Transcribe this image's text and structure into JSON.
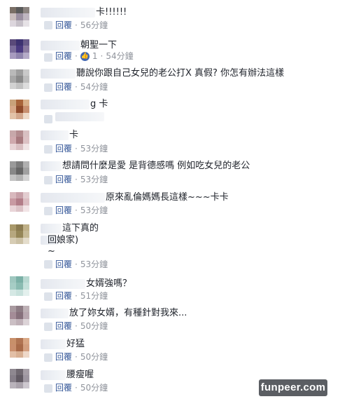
{
  "actions": {
    "reply_label": "回覆",
    "separator": "·"
  },
  "comments": [
    {
      "lines": [
        "卡!!!!!!"
      ],
      "time": "56分鐘",
      "likes": null,
      "avatar": [
        "#7a6f66",
        "#5a5a5a",
        "#8c8480",
        "#c9bdbd",
        "#9a8fa0",
        "#bfb6c0",
        "#dcd6dd",
        "#c6c0c8",
        "#e6e2e6"
      ]
    },
    {
      "lines": [
        "朝聖一下"
      ],
      "time": "54分鐘",
      "likes": "1",
      "avatar": [
        "#5a4a7a",
        "#3d3270",
        "#6a5c8a",
        "#7a6c9a",
        "#4a3a80",
        "#8a7aa0",
        "#a79bbf",
        "#8f84ad",
        "#b5abc8"
      ]
    },
    {
      "lines": [
        "聽說你跟自己女兒的老公打X 真假? 你怎有辦法這樣"
      ],
      "time": "54分鐘",
      "likes": null,
      "avatar": [
        "#b9b9b9",
        "#9e9e9e",
        "#c9c9c9",
        "#a7a7a7",
        "#8a8a8a",
        "#bcbcbc",
        "#d2d2d2",
        "#c2c2c2",
        "#dddddd"
      ]
    },
    {
      "lines": [
        "g 卡"
      ],
      "time": "",
      "likes": null,
      "avatar": [
        "#c9a27a",
        "#a8643a",
        "#d8b08a",
        "#d7a888",
        "#8f4a2a",
        "#c89070",
        "#e3c3a8",
        "#d2a78c",
        "#eedac8"
      ]
    },
    {
      "lines": [
        "卡"
      ],
      "time": "53分鐘",
      "likes": null,
      "avatar": [
        "#c7a8aa",
        "#b38c8f",
        "#d8c0c2",
        "#cfa9ad",
        "#a7797e",
        "#dcc1c4",
        "#e8d4d6",
        "#d9bfc2",
        "#f0e4e5"
      ]
    },
    {
      "lines": [
        "想請問什麼是愛 是背德感嗎 例如吃女兒的老公"
      ],
      "time": "53分鐘",
      "likes": null,
      "avatar": [
        "#9a9a9a",
        "#7c7c7c",
        "#b0b0b0",
        "#888888",
        "#666666",
        "#a0a0a0",
        "#c3c3c3",
        "#b2b2b2",
        "#d3d3d3"
      ]
    },
    {
      "lines": [
        "原來亂倫媽媽長這樣~~~卡卡"
      ],
      "time": "53分鐘",
      "likes": null,
      "avatar": [
        "#d8b8bd",
        "#c7a0a8",
        "#e3cdd0",
        "#c89aa2",
        "#b27d88",
        "#dbbdc2",
        "#e9d5d8",
        "#dcc3c7",
        "#f2e5e7"
      ]
    },
    {
      "lines": [
        "這下真的",
        "回娘家)",
        "~"
      ],
      "time": "53分鐘",
      "likes": null,
      "avatar": [
        "#a8986a",
        "#8a7a50",
        "#bfb088",
        "#b6a77f",
        "#958658",
        "#c7bb98",
        "#d6ccb4",
        "#cbc0a4",
        "#e4ddcc"
      ]
    },
    {
      "lines": [
        "女婿強嗎？"
      ],
      "time": "51分鐘",
      "likes": null,
      "avatar": [
        "#9fc7bf",
        "#7bb0a6",
        "#b9d8d1",
        "#a6cdc5",
        "#8abbb1",
        "#c4e0da",
        "#d5e8e4",
        "#c8e1dc",
        "#e3f0ed"
      ]
    },
    {
      "lines": [
        "放了妳女婿，有種針對我來..."
      ],
      "time": "50分鐘",
      "likes": null,
      "avatar": [
        "#a99aa0",
        "#8d7c84",
        "#bdb0b5",
        "#a48c97",
        "#86707b",
        "#b9a8b0",
        "#cbbfc4",
        "#bfb0b7",
        "#dcd3d7"
      ]
    },
    {
      "lines": [
        "好猛"
      ],
      "time": "50分鐘",
      "likes": null,
      "avatar": [
        "#c8906a",
        "#b07452",
        "#d9a886",
        "#c98f6d",
        "#a86a48",
        "#d3a080",
        "#e2bfa6",
        "#d8b093",
        "#eed8c8"
      ]
    },
    {
      "lines": [
        "腰瘦喔"
      ],
      "time": "50分鐘",
      "likes": null,
      "avatar": [
        "#8e8890",
        "#6f6870",
        "#a59ea6",
        "#857e88",
        "#615a63",
        "#9d96a0",
        "#b9b3bb",
        "#aaa3ac",
        "#cdc8cf"
      ]
    }
  ],
  "watermark": "funpeer.com"
}
